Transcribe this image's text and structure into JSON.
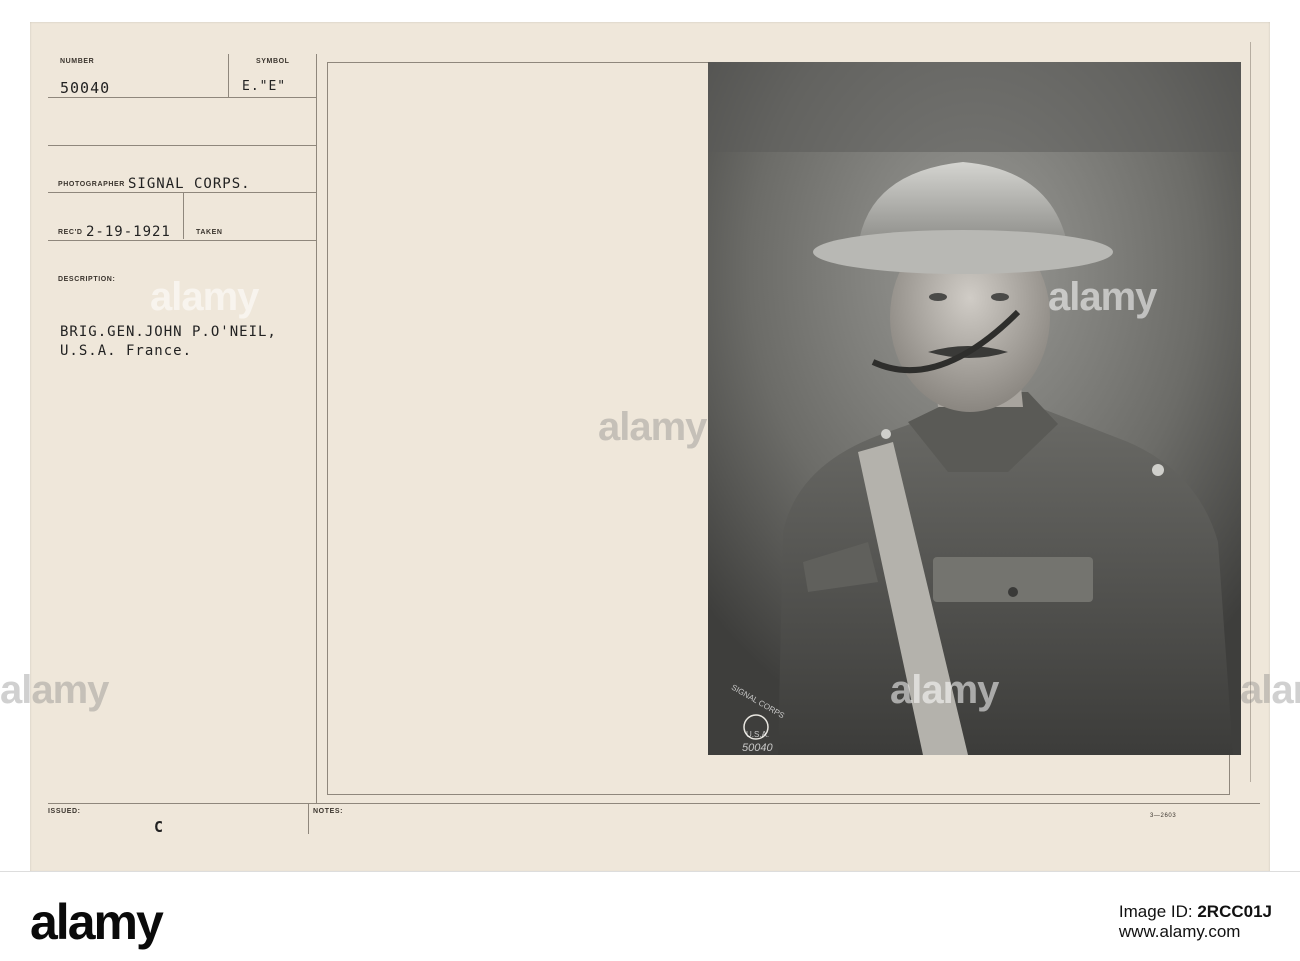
{
  "record_card": {
    "number_label": "NUMBER",
    "number_value": "50040",
    "symbol_label": "SYMBOL",
    "symbol_value": "E.\"E\"",
    "photographer_label": "PHOTOGRAPHER",
    "photographer_value": "SIGNAL CORPS.",
    "received_label": "REC'D",
    "received_value": "2-19-1921",
    "taken_label": "TAKEN",
    "description_label": "DESCRIPTION:",
    "description_line1": "BRIG.GEN.JOHN P.O'NEIL,",
    "description_line2": "U.S.A. France.",
    "issued_label": "ISSUED:",
    "issued_mark": "C",
    "notes_label": "NOTES:",
    "form_code": "3—2603"
  },
  "photo": {
    "stamp_text": "SIGNAL CORPS",
    "stamp_subtext": "U.S.A.",
    "handwritten_number": "50040"
  },
  "watermark": {
    "text": "alamy",
    "colors": {
      "paper": "#efe7da",
      "ink": "#222222"
    }
  },
  "footer": {
    "logo": "alamy",
    "image_id_label": "Image ID:",
    "image_id": "2RCC01J",
    "site": "www.alamy.com"
  }
}
